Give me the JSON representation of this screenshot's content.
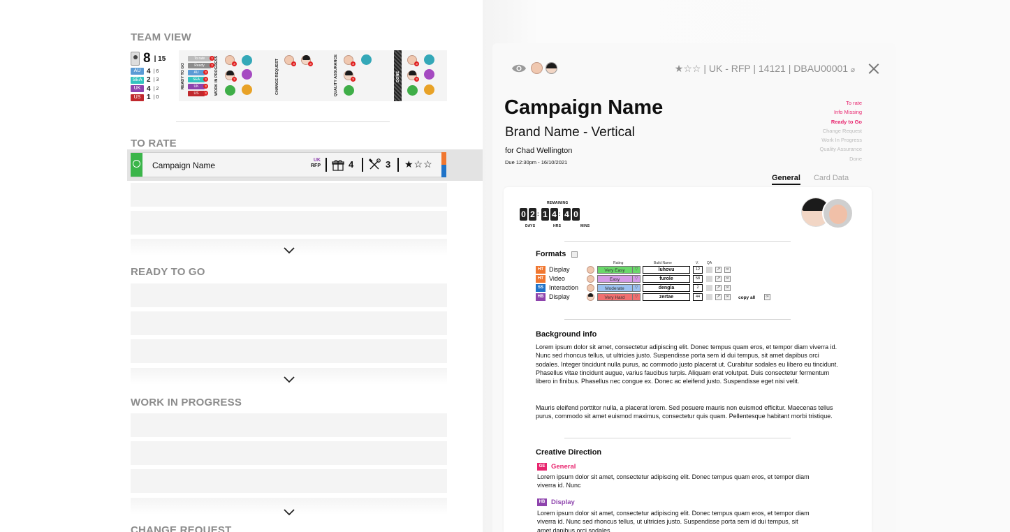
{
  "left": {
    "team_view": {
      "title": "TEAM VIEW",
      "total": "8",
      "total_of": "| 15",
      "regions": [
        {
          "code": "AU",
          "count": "4",
          "of": "| 6",
          "color": "#5b9bd5"
        },
        {
          "code": "SEA",
          "count": "2",
          "of": "| 3",
          "color": "#34c3c0"
        },
        {
          "code": "UK",
          "count": "4",
          "of": "| 2",
          "color": "#8e44ad"
        },
        {
          "code": "US",
          "count": "1",
          "of": "| 0",
          "color": "#c0282d"
        }
      ],
      "stage_labels": {
        "ready_to_go": "READY TO GO",
        "work_in_progress": "WORK IN PROGRESS",
        "change_request": "CHANGE REQUEST",
        "quality_assurance": "QUALITY ASSURANCE",
        "done": "DONE"
      },
      "stage_chips": [
        {
          "label": "To rate",
          "count": "3",
          "color": "#bcbcbc"
        },
        {
          "label": "Ready",
          "count": "3",
          "color": "#8c8c8c"
        },
        {
          "label": "AU",
          "count": "3",
          "color": "#5b9bd5"
        },
        {
          "label": "SEA",
          "count": "3",
          "color": "#34c3c0"
        },
        {
          "label": "UK",
          "count": "3",
          "color": "#8e44ad"
        },
        {
          "label": "US",
          "count": "3",
          "color": "#c0282d"
        }
      ],
      "badge_count": "3"
    },
    "to_rate": {
      "title": "TO RATE",
      "campaign": {
        "name": "Campaign Name",
        "region": "UK",
        "type": "RFP",
        "formats_count": "4",
        "tools_count": "3",
        "stars": "★☆☆"
      }
    },
    "ready_to_go": {
      "title": "READY TO GO"
    },
    "work_in_progress": {
      "title": "WORK IN PROGRESS"
    },
    "change_request": {
      "title": "CHANGE REQUEST"
    }
  },
  "detail": {
    "breadcrumb": "★☆☆ | UK - RFP | 14121 | DBAU00001",
    "title": "Campaign Name",
    "brand": "Brand Name - Vertical",
    "for": "for Chad Wellington",
    "due": "Due 12:30pm - 16/10/2021",
    "statuses": [
      {
        "label": "To rate",
        "color": "#e8256e",
        "bold": false
      },
      {
        "label": "Info Missing",
        "color": "#e8256e",
        "bold": false
      },
      {
        "label": "Ready to Go",
        "color": "#e8256e",
        "bold": true
      },
      {
        "label": "Change Request",
        "color": "#bbbbbb",
        "bold": false
      },
      {
        "label": "Work In Progress",
        "color": "#bbbbbb",
        "bold": false
      },
      {
        "label": "Quality Assurance",
        "color": "#bbbbbb",
        "bold": false
      },
      {
        "label": "Done",
        "color": "#bbbbbb",
        "bold": false
      }
    ],
    "tabs": {
      "general": "General",
      "card_data": "Card Data"
    },
    "timer": {
      "remaining_label": "REMAINING",
      "days": [
        "0",
        "2"
      ],
      "hrs": [
        "1",
        "4"
      ],
      "mins": [
        "4",
        "0"
      ],
      "days_label": "DAYS",
      "hrs_label": "HRS",
      "mins_label": "MINS"
    },
    "formats": {
      "title": "Formats",
      "col_rating": "Rating",
      "col_build": "Build Name",
      "col_version": "V.",
      "col_qa": "QA",
      "copy_all": "copy all",
      "rows": [
        {
          "badge": "HT",
          "badge_color": "#f07730",
          "name": "Display",
          "rating": "Very Easy",
          "rating_color": "#6ad86a",
          "build": "luhovu",
          "version": "12"
        },
        {
          "badge": "HT",
          "badge_color": "#f07730",
          "name": "Video",
          "rating": "Easy",
          "rating_color": "#d59be6",
          "build": "furole",
          "version": "58"
        },
        {
          "badge": "SS",
          "badge_color": "#1f73c8",
          "name": "Interaction",
          "rating": "Moderate",
          "rating_color": "#9cc1f0",
          "build": "dengla",
          "version": "2"
        },
        {
          "badge": "HB",
          "badge_color": "#8e44ad",
          "name": "Display",
          "rating": "Very Hard",
          "rating_color": "#f07070",
          "build": "zertae",
          "version": "44"
        }
      ]
    },
    "background": {
      "title": "Background info",
      "p1": "Lorem ipsum dolor sit amet, consectetur adipiscing elit. Donec tempus quam eros, et tempor diam viverra id. Nunc sed rhoncus tellus, ut ultricies justo. Suspendisse porta sem id dui tempus, sit amet dapibus orci sodales. Integer tincidunt nulla purus, ac commodo justo placerat ut. Curabitur sodales eu libero eu tincidunt. Phasellus vitae tincidunt augue, varius faucibus turpis. Aliquam erat volutpat. Duis consectetur fermentum libero in finibus. Phasellus nec congue ex. Donec ac eleifend justo. Suspendisse eget nisi velit.",
      "p2": "Mauris eleifend porttitor nulla, a placerat lorem. Sed posuere mauris non euismod efficitur. Maecenas tellus purus, commodo sit amet euismod maximus, consectetur quis quam. Pellentesque habitant morbi tristique."
    },
    "creative": {
      "title": "Creative Direction",
      "items": [
        {
          "badge": "GE",
          "badge_color": "#e8256e",
          "label": "General",
          "label_color": "#e8256e",
          "text": "Lorem ipsum dolor sit amet, consectetur adipiscing elit. Donec tempus quam eros, et tempor diam viverra id. Nunc"
        },
        {
          "badge": "HB",
          "badge_color": "#8e44ad",
          "label": "Display",
          "label_color": "#8e44ad",
          "text": "Lorem ipsum dolor sit amet, consectetur adipiscing elit. Donec tempus quam eros, et tempor diam viverra id. Nunc sed rhoncus tellus, ut ultricies justo. Suspendisse porta sem id dui tempus, sit amet dapibus orci sodales."
        }
      ]
    }
  }
}
